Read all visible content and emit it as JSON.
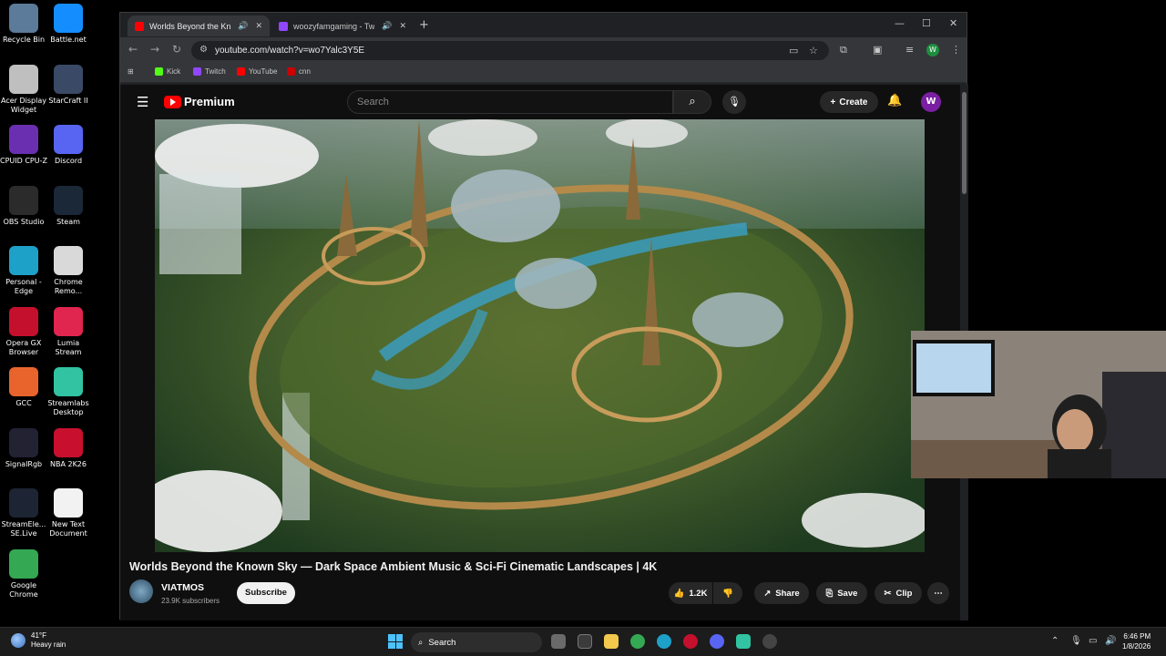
{
  "desktop": {
    "icons": [
      {
        "label": "Recycle Bin",
        "icon": "recycle-bin-icon",
        "color": "#5c7a99"
      },
      {
        "label": "Battle.net",
        "icon": "battlenet-icon",
        "color": "#148eff"
      },
      {
        "label": "Acer Display Widget",
        "icon": "acer-display-icon",
        "color": "#bfbfbf"
      },
      {
        "label": "StarCraft II",
        "icon": "starcraft-icon",
        "color": "#3a4a66"
      },
      {
        "label": "CPUID CPU-Z",
        "icon": "cpuz-icon",
        "color": "#6a2fb0"
      },
      {
        "label": "Discord",
        "icon": "discord-icon",
        "color": "#5865f2"
      },
      {
        "label": "OBS Studio",
        "icon": "obs-icon",
        "color": "#2b2b2b"
      },
      {
        "label": "Steam",
        "icon": "steam-icon",
        "color": "#1b2838"
      },
      {
        "label": "Personal - Edge",
        "icon": "edge-icon",
        "color": "#1ea1c9"
      },
      {
        "label": "Chrome Remo...",
        "icon": "chrome-remote-icon",
        "color": "#d9d9d9"
      },
      {
        "label": "Opera GX Browser",
        "icon": "opera-gx-icon",
        "color": "#c4102c"
      },
      {
        "label": "Lumia Stream",
        "icon": "lumia-icon",
        "color": "#e0254f"
      },
      {
        "label": "GCC",
        "icon": "gcc-icon",
        "color": "#e8642c"
      },
      {
        "label": "Streamlabs Desktop",
        "icon": "streamlabs-icon",
        "color": "#31c3a2"
      },
      {
        "label": "SignalRgb",
        "icon": "signalrgb-icon",
        "color": "#222233"
      },
      {
        "label": "NBA 2K26",
        "icon": "nba2k-icon",
        "color": "#c8102e"
      },
      {
        "label": "StreamEle... SE.Live",
        "icon": "streamelements-icon",
        "color": "#1d2433"
      },
      {
        "label": "New Text Document",
        "icon": "text-document-icon",
        "color": "#f2f2f2"
      },
      {
        "label": "Google Chrome",
        "icon": "chrome-icon",
        "color": "#34a853"
      }
    ]
  },
  "browser": {
    "tabs": [
      {
        "title": "Worlds Beyond the Known",
        "fav_color": "#ff0000",
        "active": true
      },
      {
        "title": "woozyfamgaming - Twitch",
        "fav_color": "#9146ff",
        "active": false
      }
    ],
    "new_tab": "+",
    "url": "youtube.com/watch?v=wo7Yalc3Y5E",
    "profile_initial": "W",
    "bookmarks": [
      {
        "label": "Kick",
        "color": "#53fc18"
      },
      {
        "label": "Twitch",
        "color": "#9146ff"
      },
      {
        "label": "YouTube",
        "color": "#ff0000"
      },
      {
        "label": "cnn",
        "color": "#cc0000"
      }
    ]
  },
  "youtube": {
    "logo_text": "Premium",
    "search_placeholder": "Search",
    "create_label": "Create",
    "avatar_initial": "W",
    "video_title": "Worlds Beyond the Known Sky — Dark Space Ambient Music & Sci-Fi Cinematic Landscapes | 4K",
    "channel_name": "VIATMOS",
    "subscribers": "23.9K subscribers",
    "subscribe_label": "Subscribe",
    "like_count": "1.2K",
    "share_label": "Share",
    "save_label": "Save",
    "clip_label": "Clip"
  },
  "taskbar": {
    "temperature": "41°F",
    "weather": "Heavy rain",
    "search_label": "Search",
    "time": "6:46 PM",
    "date": "1/8/2026"
  }
}
